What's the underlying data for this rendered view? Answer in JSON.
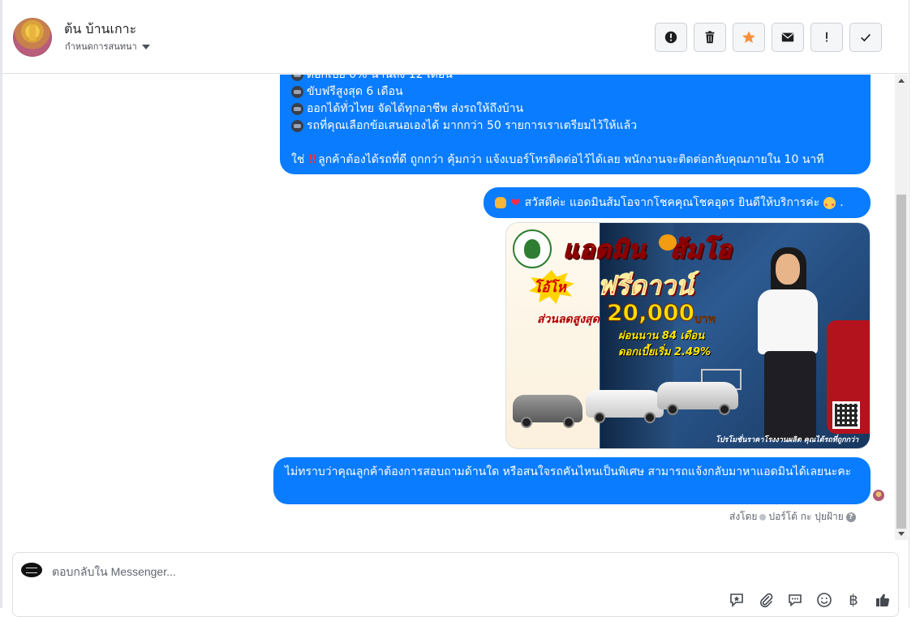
{
  "header": {
    "contact_name": "ต้น บ้านเกาะ",
    "status_label": "กำหนดการสนทนา",
    "actions": [
      {
        "name": "mark-spam-button",
        "icon": "alert-circle-icon"
      },
      {
        "name": "delete-button",
        "icon": "trash-icon"
      },
      {
        "name": "star-button",
        "icon": "star-icon"
      },
      {
        "name": "email-button",
        "icon": "envelope-icon"
      },
      {
        "name": "mark-important-button",
        "icon": "exclamation-icon"
      },
      {
        "name": "mark-done-button",
        "icon": "check-icon"
      }
    ]
  },
  "messages": {
    "first": {
      "partial_line": "ดอกเบี้ย 0% นานถึง 12 เดือน",
      "lines": [
        "ขับฟรีสูงสุด 6 เดือน",
        "ออกได้ทั่วไทย จัดได้ทุกอาชีพ ส่งรถให้ถึงบ้าน",
        "รถที่คุณเลือกข้อเสนอเองได้ มากกว่า 50 รายการเราเตรียมไว้ให้แล้ว"
      ],
      "closing_prefix": "ใช่",
      "closing_text": "ลูกค้าต้องได้รถที่ดี ถูกกว่า คุ้มกว่า แจ้งเบอร์โทรติดต่อไว้ได้เลย พนักงานจะติดต่อกลับคุณภายใน 10 นาที"
    },
    "greeting": "สวัสดีค่ะ แอดมินส้มโอจากโชคคุณโชคอุดร ยินดีให้บริการค่ะ",
    "greeting_suffix": ".",
    "question": "ไม่ทราบว่าคุณลูกค้าต้องการสอบถามด้านใด หรือสนใจรถคันไหนเป็นพิเศษ สามารถแจ้งกลับมาหาแอดมินได้เลยนะคะ"
  },
  "ad": {
    "title": "แอดมิน",
    "title_name": "ส้มโอ",
    "burst_text": "โอ้โห",
    "headline": "ฟรีดาวน์",
    "discount_label": "ส่วนลดสูงสุด",
    "discount_amount": "20,000",
    "currency": "บาท",
    "installment": "ผ่อนนาน 84 เดือน",
    "interest": "ดอกเบี้ยเริ่ม 2.49%",
    "caption": "โปรโมชั่นราคาโรงงานผลิต คุณได้รถที่ถูกกว่า"
  },
  "sent_by": {
    "prefix": "ส่งโดย",
    "name": "ปอร์โต้ กะ ปุยฝ้าย",
    "help": "?"
  },
  "composer": {
    "placeholder": "ตอบกลับใน Messenger...",
    "tools": [
      {
        "name": "saved-reply-button",
        "icon": "saved-reply-icon"
      },
      {
        "name": "attach-button",
        "icon": "paperclip-icon"
      },
      {
        "name": "quick-reply-button",
        "icon": "chat-bubble-icon"
      },
      {
        "name": "emoji-button",
        "icon": "smiley-icon"
      },
      {
        "name": "payment-button",
        "icon": "baht-icon",
        "glyph": "฿"
      },
      {
        "name": "like-button",
        "icon": "thumbs-up-icon"
      }
    ]
  },
  "colors": {
    "bubble": "#0a7cff",
    "star": "#f7923b"
  }
}
